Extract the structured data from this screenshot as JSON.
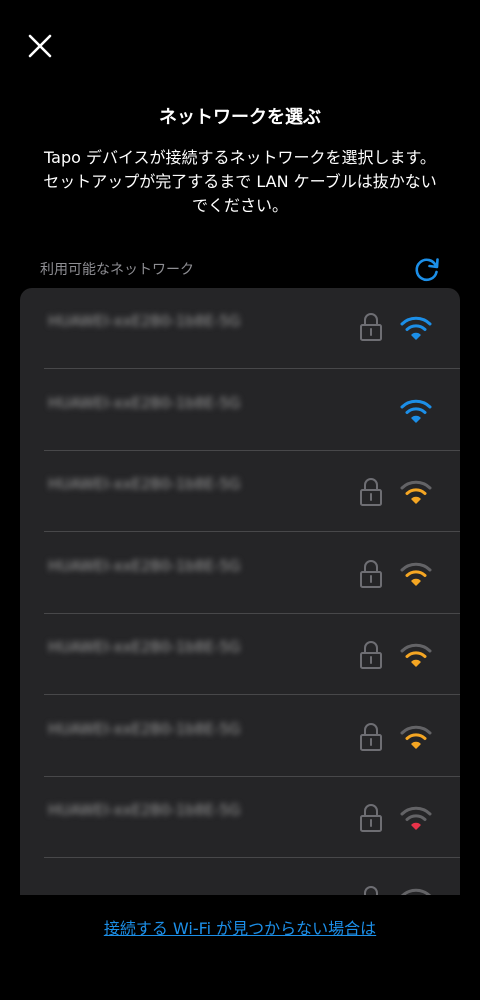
{
  "header": {
    "title": "ネットワークを選ぶ",
    "description": "Tapo デバイスが接続するネットワークを選択します。セットアップが完了するまで LAN ケーブルは抜かないでください。"
  },
  "network_list": {
    "section_label": "利用可能なネットワーク",
    "networks": [
      {
        "ssid": "HUAWEI-xxE2B0-1b8E-5G",
        "secured": true,
        "signal_bars": 3,
        "signal_color": "#1c8fe8"
      },
      {
        "ssid": "HUAWEI-xxE2B0-1b8E-5G",
        "secured": false,
        "signal_bars": 3,
        "signal_color": "#1c8fe8"
      },
      {
        "ssid": "HUAWEI-xxE2B0-1b8E-5G",
        "secured": true,
        "signal_bars": 2,
        "signal_color": "#f5a623"
      },
      {
        "ssid": "HUAWEI-xxE2B0-1b8E-5G",
        "secured": true,
        "signal_bars": 2,
        "signal_color": "#f5a623"
      },
      {
        "ssid": "HUAWEI-xxE2B0-1b8E-5G",
        "secured": true,
        "signal_bars": 2,
        "signal_color": "#f5a623"
      },
      {
        "ssid": "HUAWEI-xxE2B0-1b8E-5G",
        "secured": true,
        "signal_bars": 2,
        "signal_color": "#f5a623"
      },
      {
        "ssid": "HUAWEI-xxE2B0-1b8E-5G",
        "secured": true,
        "signal_bars": 1,
        "signal_color": "#e8334a"
      },
      {
        "ssid": "",
        "secured": true,
        "signal_bars": 0,
        "signal_color": "#8e8e93"
      }
    ]
  },
  "footer": {
    "help_link": "接続する Wi-Fi が見つからない場合は"
  },
  "colors": {
    "accent": "#1c8fe8",
    "background": "#000000",
    "list_background": "#252527",
    "inactive_signal": "#636366"
  },
  "icons": {
    "close": "close-icon",
    "refresh": "refresh-icon",
    "lock": "lock-icon",
    "wifi": "wifi-icon"
  }
}
